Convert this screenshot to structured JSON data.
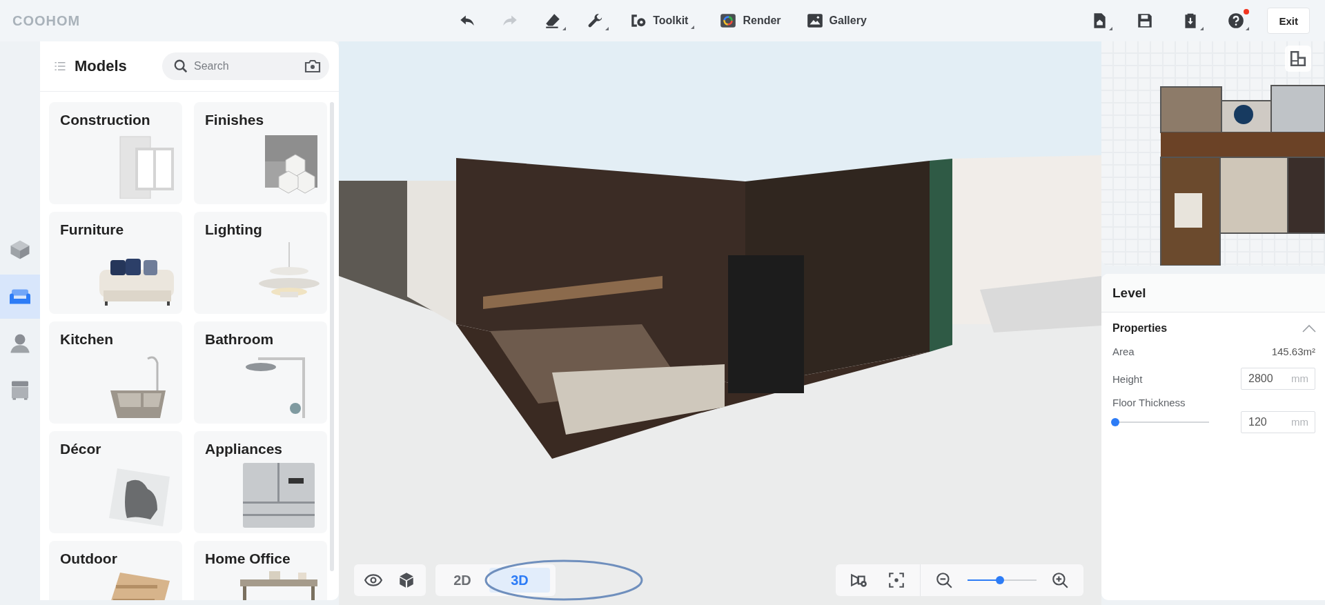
{
  "topbar": {
    "logo": "COOHOM",
    "history": [
      {
        "kind": "undo",
        "disabled": false
      },
      {
        "kind": "redo",
        "disabled": true
      }
    ],
    "tools": [
      {
        "kind": "eraser",
        "dropdown": true
      },
      {
        "kind": "wrench",
        "dropdown": true
      },
      {
        "kind": "toolkit",
        "label": "Toolkit",
        "dropdown": true
      },
      {
        "kind": "render",
        "label": "Render"
      },
      {
        "kind": "gallery",
        "label": "Gallery"
      }
    ],
    "actions": [
      {
        "kind": "home",
        "dropdown": true
      },
      {
        "kind": "save"
      },
      {
        "kind": "download",
        "dropdown": true
      },
      {
        "kind": "help",
        "dropdown": true,
        "notification": true
      }
    ],
    "exit": "Exit"
  },
  "rail": [
    {
      "kind": "construction",
      "selected": false
    },
    {
      "kind": "furniture",
      "selected": true
    },
    {
      "kind": "user",
      "selected": false
    },
    {
      "kind": "cabinet",
      "selected": false
    }
  ],
  "models": {
    "title": "Models",
    "search": {
      "placeholder": "Search"
    },
    "categories": [
      {
        "label": "Construction"
      },
      {
        "label": "Finishes"
      },
      {
        "label": "Furniture"
      },
      {
        "label": "Lighting"
      },
      {
        "label": "Kitchen"
      },
      {
        "label": "Bathroom"
      },
      {
        "label": "Décor"
      },
      {
        "label": "Appliances"
      },
      {
        "label": "Outdoor"
      },
      {
        "label": "Home Office"
      }
    ]
  },
  "level": {
    "title": "Level",
    "section": {
      "title": "Properties",
      "expanded": true,
      "fields": [
        {
          "kind": "value",
          "label": "Area",
          "value": "145.63m²"
        },
        {
          "kind": "input",
          "label": "Height",
          "value": "2800",
          "unit": "mm"
        },
        {
          "kind": "slider",
          "label": "Floor Thickness",
          "level": 0.0,
          "value": "120",
          "unit": "mm"
        }
      ]
    }
  },
  "view": {
    "modes": [
      {
        "label": "2D",
        "selected": false
      },
      {
        "label": "3D",
        "selected": true
      }
    ],
    "zoom": {
      "level": 0.47
    }
  }
}
